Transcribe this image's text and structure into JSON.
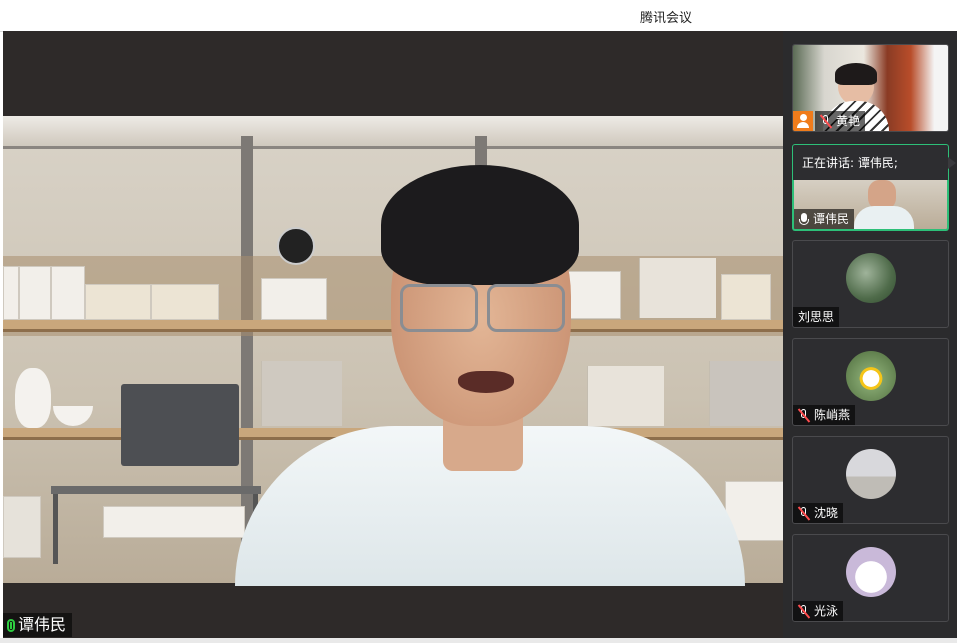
{
  "window": {
    "title": "腾讯会议"
  },
  "main_video": {
    "speaker_name": "谭伟民",
    "mic_state": "speaking",
    "mic_icon": "mic-active-icon"
  },
  "sidebar": {
    "speaking_label": "正在讲话: 谭伟民;",
    "participants": [
      {
        "name": "黄艳",
        "mic_icon": "mic-muted-icon",
        "is_host": true,
        "video": true
      },
      {
        "name": "谭伟民",
        "mic_icon": "mic-icon",
        "is_host": false,
        "video": true,
        "speaking": true
      },
      {
        "name": "刘思思",
        "mic_icon": "",
        "is_host": false,
        "video": false
      },
      {
        "name": "陈峭燕",
        "mic_icon": "mic-muted-icon",
        "is_host": false,
        "video": false
      },
      {
        "name": "沈晓",
        "mic_icon": "mic-muted-icon",
        "is_host": false,
        "video": false
      },
      {
        "name": "光泳",
        "mic_icon": "mic-muted-icon",
        "is_host": false,
        "video": false
      }
    ]
  },
  "colors": {
    "speaking_border": "#2dbf78",
    "host_badge": "#f07c1b",
    "muted_slash": "#ff4d4f",
    "active_mic": "#2ecc40"
  }
}
